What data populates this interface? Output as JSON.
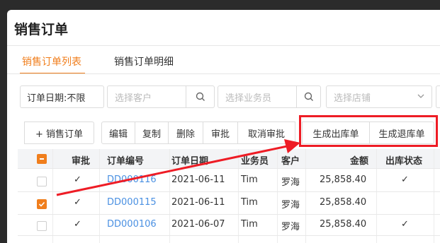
{
  "page": {
    "title": "销售订单"
  },
  "tabs": [
    {
      "label": "销售订单列表",
      "active": true
    },
    {
      "label": "销售订单明细",
      "active": false
    }
  ],
  "filters": {
    "date_value": "订单日期:不限",
    "customer_placeholder": "选择客户",
    "salesperson_placeholder": "选择业务员",
    "store_placeholder": "选择店铺"
  },
  "toolbar": {
    "add_label": "+ 销售订单",
    "edit_label": "编辑",
    "copy_label": "复制",
    "delete_label": "删除",
    "approve_label": "审批",
    "unapprove_label": "取消审批",
    "gen_out_label": "生成出库单",
    "gen_return_label": "生成退库单"
  },
  "table": {
    "headers": [
      "审批",
      "订单编号",
      "订单日期",
      "业务员",
      "客户",
      "金额",
      "出库状态"
    ],
    "rows": [
      {
        "checked": false,
        "approved": "✓",
        "order_no": "DD000116",
        "date": "2021-06-11",
        "salesperson": "Tim",
        "customer": "罗海",
        "amount": "25,858.40",
        "out_status": "✓"
      },
      {
        "checked": true,
        "approved": "✓",
        "order_no": "DD000115",
        "date": "2021-06-11",
        "salesperson": "Tim",
        "customer": "罗海",
        "amount": "25,858.40",
        "out_status": ""
      },
      {
        "checked": false,
        "approved": "✓",
        "order_no": "DD000106",
        "date": "2021-06-07",
        "salesperson": "Tim",
        "customer": "罗海",
        "amount": "25,858.40",
        "out_status": "✓"
      }
    ]
  },
  "colors": {
    "accent": "#f07e1c",
    "link": "#4a90e2",
    "annotation": "#ee1c25"
  }
}
